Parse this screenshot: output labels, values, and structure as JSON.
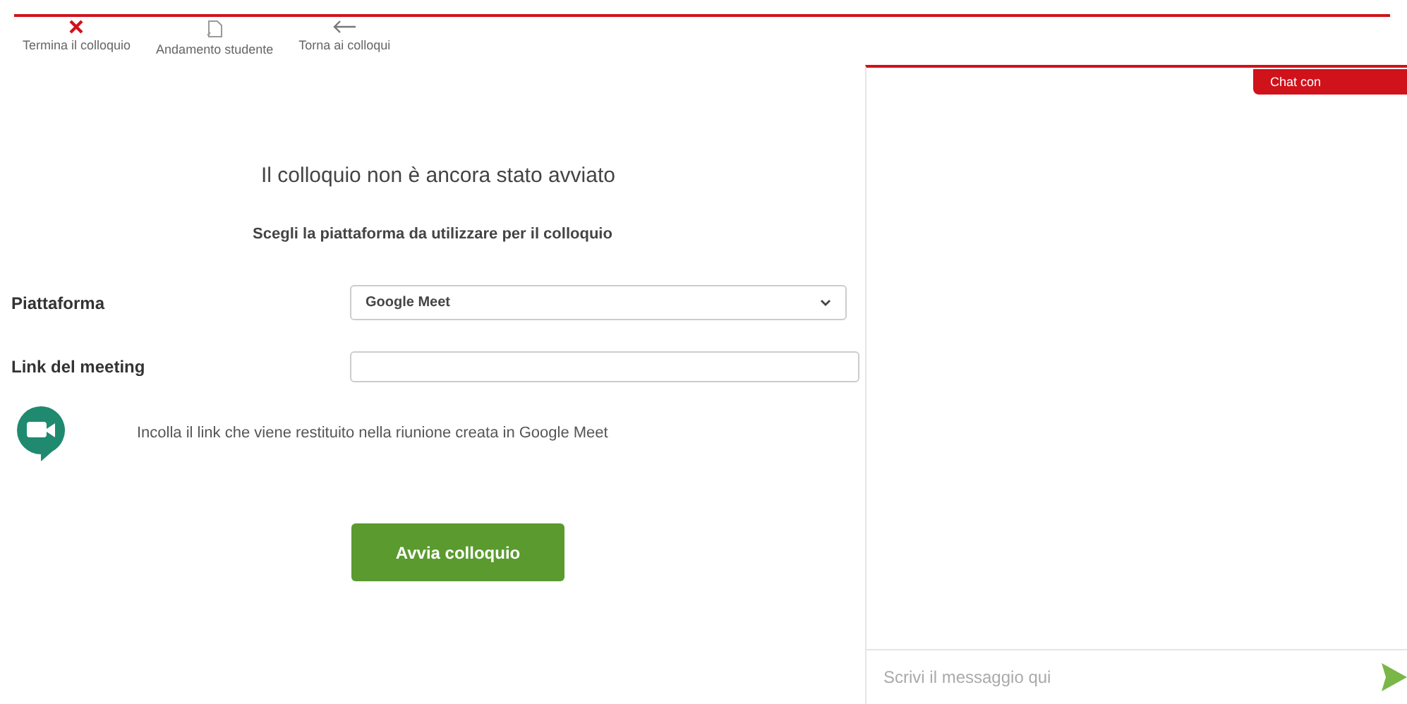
{
  "toolbar": [
    {
      "kind": "close",
      "label": "Termina il colloquio"
    },
    {
      "kind": "document",
      "label": "Andamento studente"
    },
    {
      "kind": "back",
      "label": "Torna ai colloqui"
    }
  ],
  "main": {
    "title": "Il colloquio non è ancora stato avviato",
    "subtitle": "Scegli la piattaforma da utilizzare per il colloquio",
    "platform": {
      "label": "Piattaforma",
      "value": "Google Meet"
    },
    "link": {
      "label": "Link del meeting"
    },
    "hint": "Incolla il link che viene restituito nella riunione creata in Google Meet",
    "start_button": "Avvia colloquio"
  },
  "chat": {
    "tab": "Chat con",
    "input": {
      "placeholder": "Scrivi il messaggio qui"
    }
  }
}
